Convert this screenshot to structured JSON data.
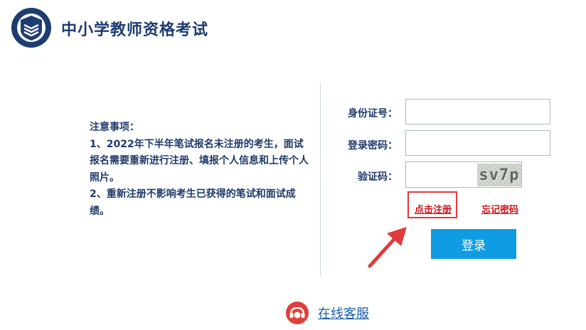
{
  "header": {
    "title": "中小学教师资格考试",
    "logo_icon": "book-shield-logo-icon"
  },
  "notice": {
    "heading": "注意事项：",
    "item1": "1、2022年下半年笔试报名未注册的考生，面试报名需要重新进行注册、填报个人信息和上传个人照片。",
    "item2": "2、重新注册不影响考生已获得的笔试和面试成绩。"
  },
  "login_form": {
    "id_label": "身份证号：",
    "id_value": "",
    "password_label": "登录密码：",
    "password_value": "",
    "captcha_label": "验证码：",
    "captcha_value": "",
    "captcha_text": "sv7p",
    "register_link": "点击注册",
    "forgot_link": "忘记密码",
    "login_button": "登录"
  },
  "footer": {
    "service_link": "在线客服",
    "service_icon": "online-service-icon"
  },
  "colors": {
    "brand": "#1d3c72",
    "accent": "#0f9ce2",
    "link_red": "#c8161d",
    "highlight_box": "#e23a3a"
  }
}
